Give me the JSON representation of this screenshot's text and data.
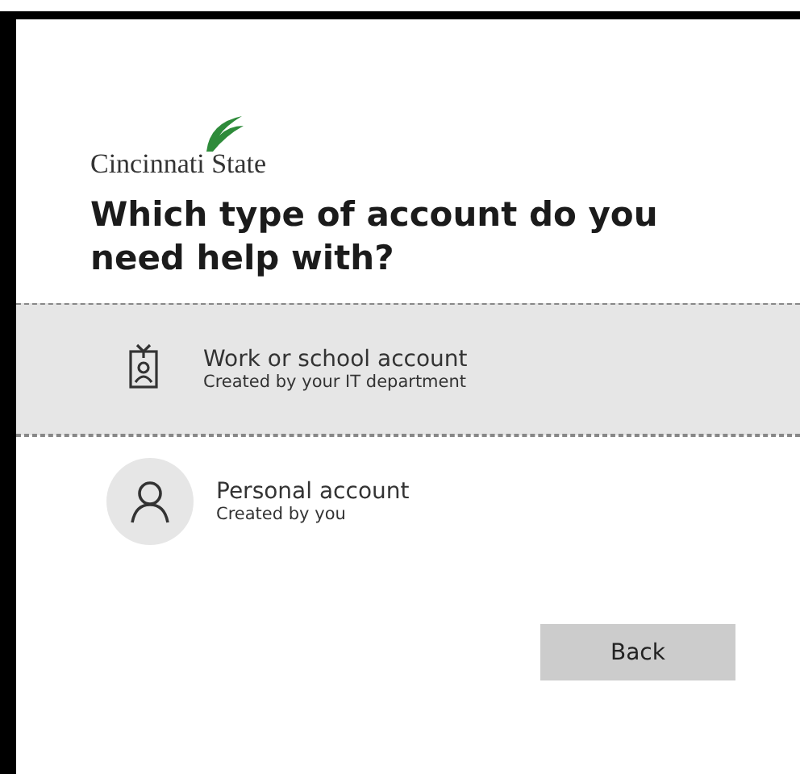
{
  "logo": {
    "text": "Cincinnati State"
  },
  "heading": "Which type of account do you need help with?",
  "options": [
    {
      "kind": "badge",
      "title": "Work or school account",
      "subtitle": "Created by your IT department",
      "selected": true
    },
    {
      "kind": "person",
      "title": "Personal account",
      "subtitle": "Created by you",
      "selected": false
    }
  ],
  "back_button": "Back"
}
